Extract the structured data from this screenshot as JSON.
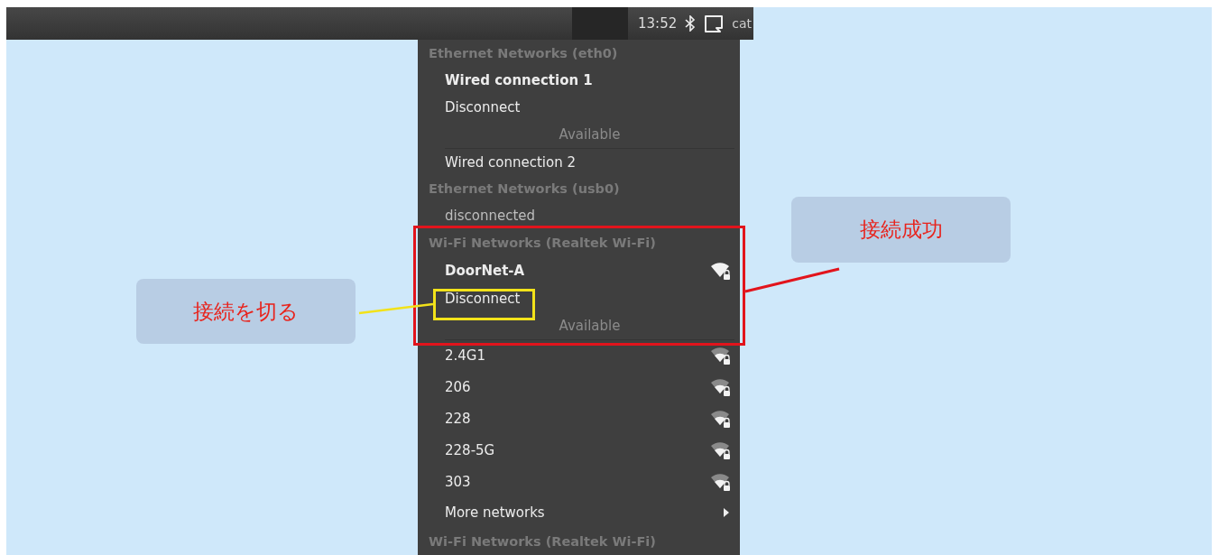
{
  "top_bar": {
    "time": "13:52",
    "user": "cat"
  },
  "menu": {
    "items": [
      {
        "kind": "header",
        "text": "Ethernet Networks (eth0)"
      },
      {
        "kind": "wired",
        "text": "Wired connection 1",
        "connected": true
      },
      {
        "kind": "action",
        "text": "Disconnect"
      },
      {
        "kind": "divider",
        "text": "Available"
      },
      {
        "kind": "wired",
        "text": "Wired connection 2",
        "connected": false
      },
      {
        "kind": "header",
        "text": "Ethernet Networks (usb0)"
      },
      {
        "kind": "status",
        "text": "disconnected"
      },
      {
        "kind": "header",
        "text": "Wi-Fi Networks (Realtek Wi-Fi)"
      },
      {
        "kind": "wifi",
        "text": "DoorNet-A",
        "connected": true
      },
      {
        "kind": "action",
        "text": "Disconnect"
      },
      {
        "kind": "divider",
        "text": "Available"
      },
      {
        "kind": "wifi",
        "text": "2.4G1",
        "connected": false
      },
      {
        "kind": "wifi",
        "text": "206",
        "connected": false
      },
      {
        "kind": "wifi",
        "text": "228",
        "connected": false
      },
      {
        "kind": "wifi",
        "text": "228-5G",
        "connected": false
      },
      {
        "kind": "wifi",
        "text": "303",
        "connected": false
      },
      {
        "kind": "submenu",
        "text": "More networks"
      },
      {
        "kind": "header",
        "text": "Wi-Fi Networks (Realtek Wi-Fi)"
      }
    ]
  },
  "annotations": [
    {
      "kind": "callout",
      "text": "接続成功"
    },
    {
      "kind": "callout",
      "text": "接続を切る"
    }
  ]
}
